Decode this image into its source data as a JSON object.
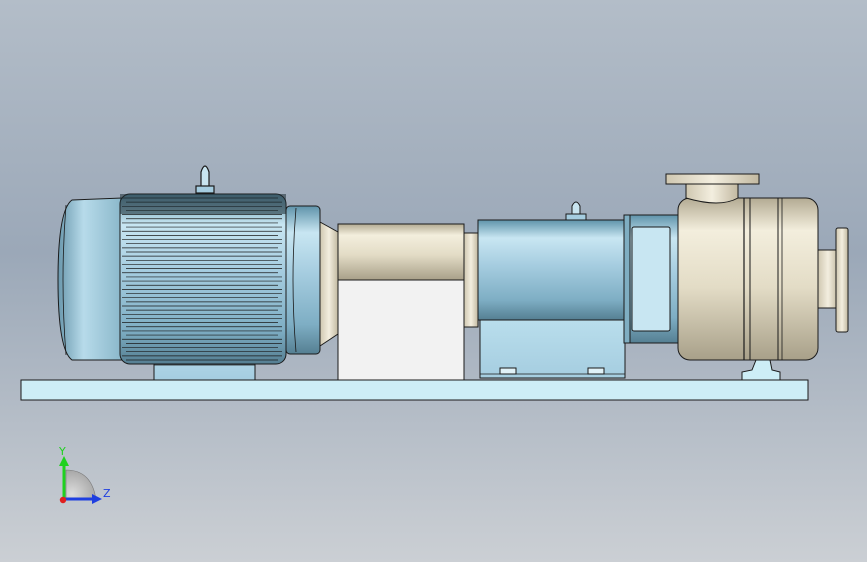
{
  "viewport": {
    "background_top": "#b5bec8",
    "background_mid": "#9aa7b8",
    "background_bottom": "#c8ccd2"
  },
  "colors": {
    "motor_body": "#9cc6d8",
    "stainless": "#e2dcc7",
    "baseplate": "#cdeef6",
    "outline": "#1a1a1a"
  },
  "triad": {
    "y_label": "Y",
    "z_label": "Z",
    "y_color": "#1fd11f",
    "z_color": "#1f3fe0",
    "x_color": "#e01f1f"
  }
}
